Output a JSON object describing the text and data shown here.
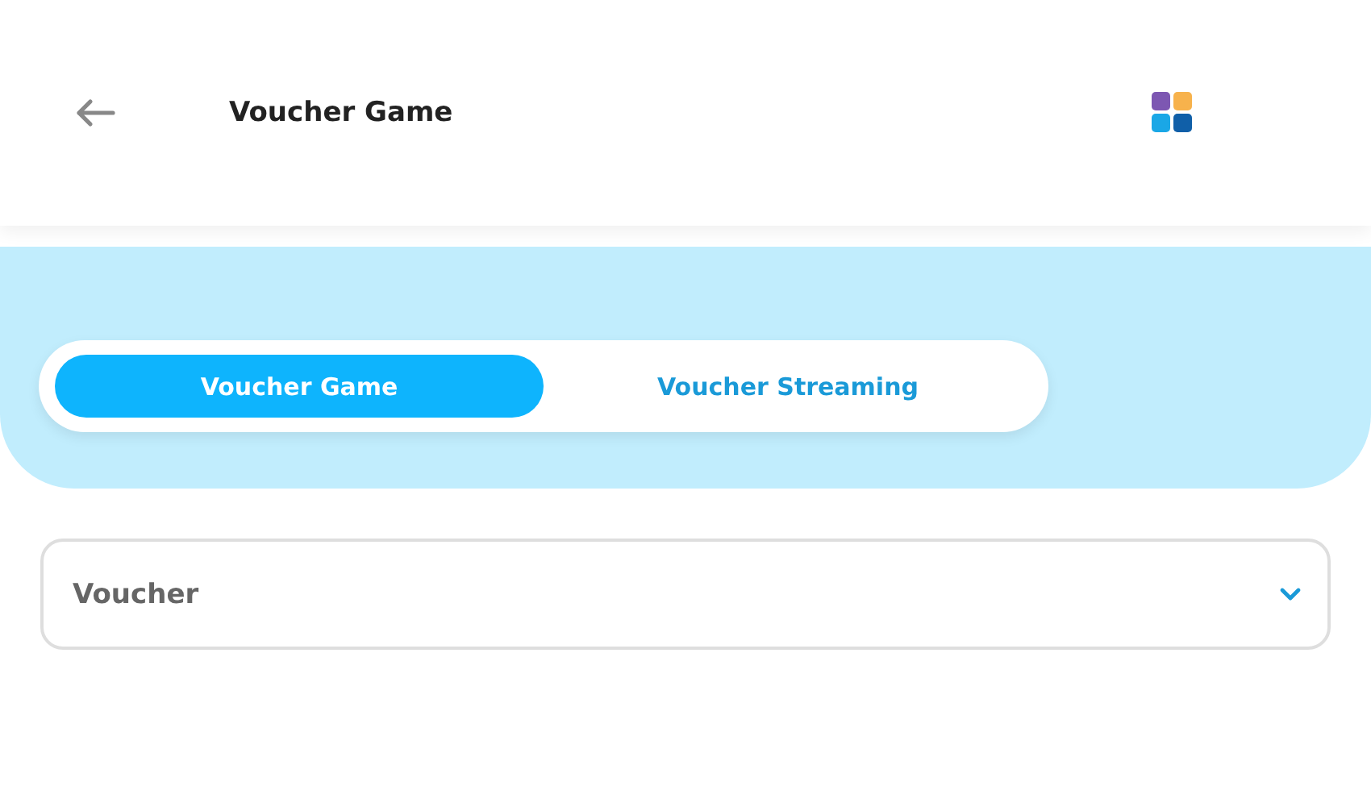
{
  "header": {
    "title": "Voucher Game"
  },
  "tabs": [
    {
      "label": "Voucher Game",
      "selected": true
    },
    {
      "label": "Voucher Streaming",
      "selected": false
    }
  ],
  "voucher_select": {
    "placeholder": "Voucher"
  }
}
